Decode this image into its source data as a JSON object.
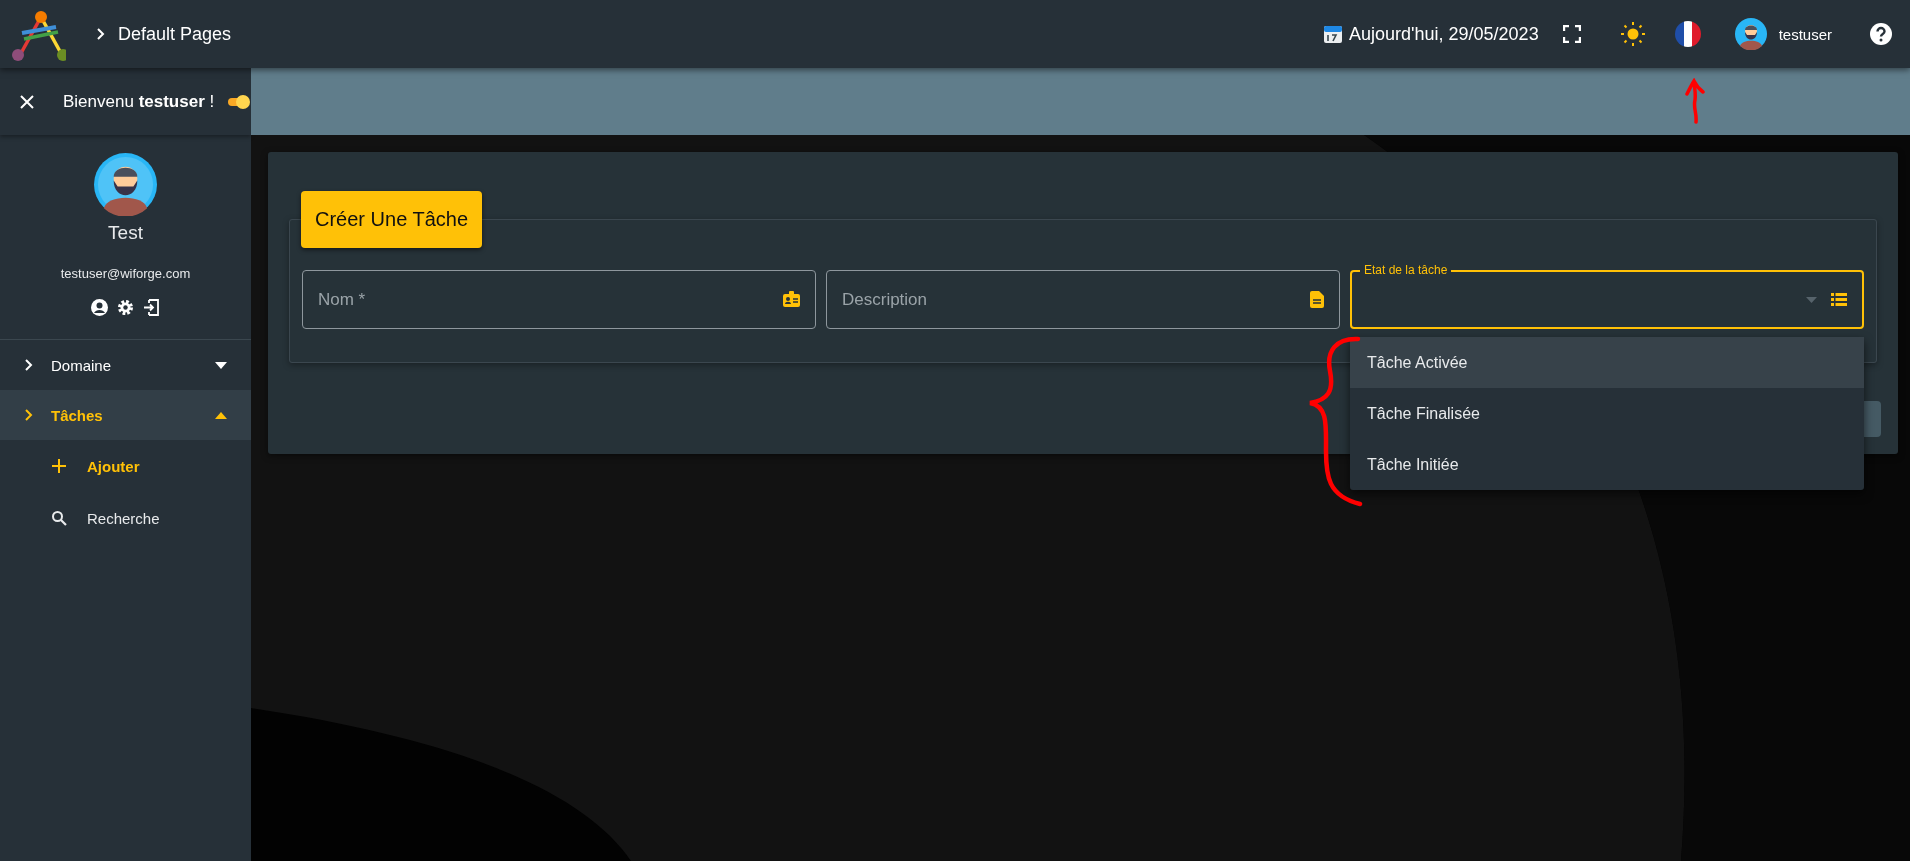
{
  "topbar": {
    "breadcrumb": "Default Pages",
    "date": "Aujourd'hui, 29/05/2023",
    "username": "testuser"
  },
  "sidebar": {
    "welcome": "Bienvenu **testuser** !",
    "toggle_on": true,
    "profile": {
      "name": "Test",
      "email": "testuser@wiforge.com"
    },
    "menu": [
      {
        "label": "Domaine",
        "expanded": false,
        "selected": false
      },
      {
        "label": "Tâches",
        "expanded": true,
        "selected": true,
        "children": [
          {
            "label": "Ajouter",
            "kind": "add",
            "selected": true
          },
          {
            "label": "Recherche",
            "kind": "search",
            "selected": false
          }
        ]
      }
    ]
  },
  "form": {
    "title": "Créer Une Tâche",
    "fields": [
      {
        "kind": "input",
        "placeholder": "Nom *"
      },
      {
        "kind": "input",
        "placeholder": "Description"
      },
      {
        "kind": "select",
        "label": "Etat de la tâche",
        "focused": true,
        "options": [
          {
            "label": "Tâche Activée",
            "highlighted": true
          },
          {
            "label": "Tâche Finalisée",
            "highlighted": false
          },
          {
            "label": "Tâche Initiée",
            "highlighted": false
          }
        ]
      }
    ]
  },
  "annotations": {
    "arrow": {
      "color": "#ff0000"
    },
    "brace": {
      "color": "#ff0000"
    }
  }
}
